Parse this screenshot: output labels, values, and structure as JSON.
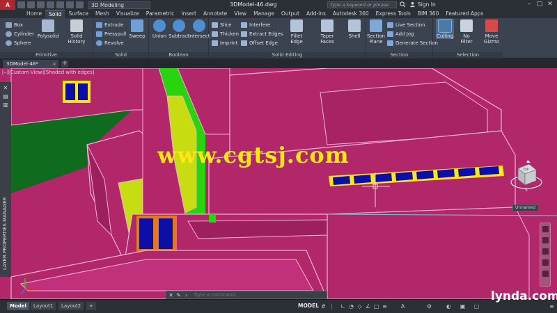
{
  "titlebar": {
    "app_logo": "A",
    "workspace": "3D Modeling",
    "document_title": "3DModel-46.dwg",
    "search_placeholder": "Type a keyword or phrase",
    "sign_in": "Sign In",
    "controls": [
      "–",
      "□",
      "✕"
    ]
  },
  "ribbon_tabs": [
    "Home",
    "Solid",
    "Surface",
    "Mesh",
    "Visualize",
    "Parametric",
    "Insert",
    "Annotate",
    "View",
    "Manage",
    "Output",
    "Add-ins",
    "Autodesk 360",
    "Express Tools",
    "BIM 360",
    "Featured Apps"
  ],
  "active_tab": "Solid",
  "panels": {
    "primitive": {
      "label": "Primitive",
      "small": [
        "Box",
        "Cylinder",
        "Sphere"
      ],
      "big": [
        "Polysolid",
        "Solid History"
      ]
    },
    "solid": {
      "label": "Solid",
      "small": [
        "Extrude",
        "Presspull",
        "Revolve"
      ],
      "big": [
        "Sweep"
      ]
    },
    "boolean": {
      "label": "Boolean",
      "big": [
        "Union",
        "Subtract",
        "Intersect"
      ]
    },
    "solid_editing": {
      "label": "Solid Editing",
      "small_col1": [
        "Slice",
        "Thicken",
        "Imprint"
      ],
      "small_col2": [
        "Interfere",
        "Extract Edges",
        "Offset Edge"
      ],
      "big": [
        "Fillet Edge",
        "Taper Faces",
        "Shell"
      ]
    },
    "section": {
      "label": "Section",
      "big": [
        "Section Plane"
      ],
      "small": [
        "Live Section",
        "Add Jog",
        "Generate Section"
      ]
    },
    "selection": {
      "label": "Selection",
      "big": [
        "Culling",
        "No Filter",
        "Move Gizmo"
      ]
    }
  },
  "file_tab": {
    "name": "3DModel-46*",
    "close": "×",
    "new": "+"
  },
  "viewport": {
    "view_label": "[–][Custom View][Shaded with edges]",
    "palette_label": "LAYER PROPERTIES MANAGER",
    "watermark": "www.cgtsj.com",
    "viewcube_face": "TOP",
    "viewcube_compass": "S",
    "wcs": "Unnamed"
  },
  "command_line": {
    "placeholder": "Type a command"
  },
  "status": {
    "layouts": [
      "Model",
      "Layout1",
      "Layout2"
    ],
    "active_layout": "Model",
    "model_label": "MODEL",
    "brand": "lynda.com"
  },
  "colors": {
    "building": "#b2266a",
    "edges": "#f0b4d8",
    "ground": "#0f6b1e",
    "window_glass": "#0b0fa8",
    "window_frame": "#ffe617",
    "yellow_green": "#c8dc12",
    "green": "#27d40e",
    "door": "#e37a1a",
    "watermark": "#ffe617"
  }
}
